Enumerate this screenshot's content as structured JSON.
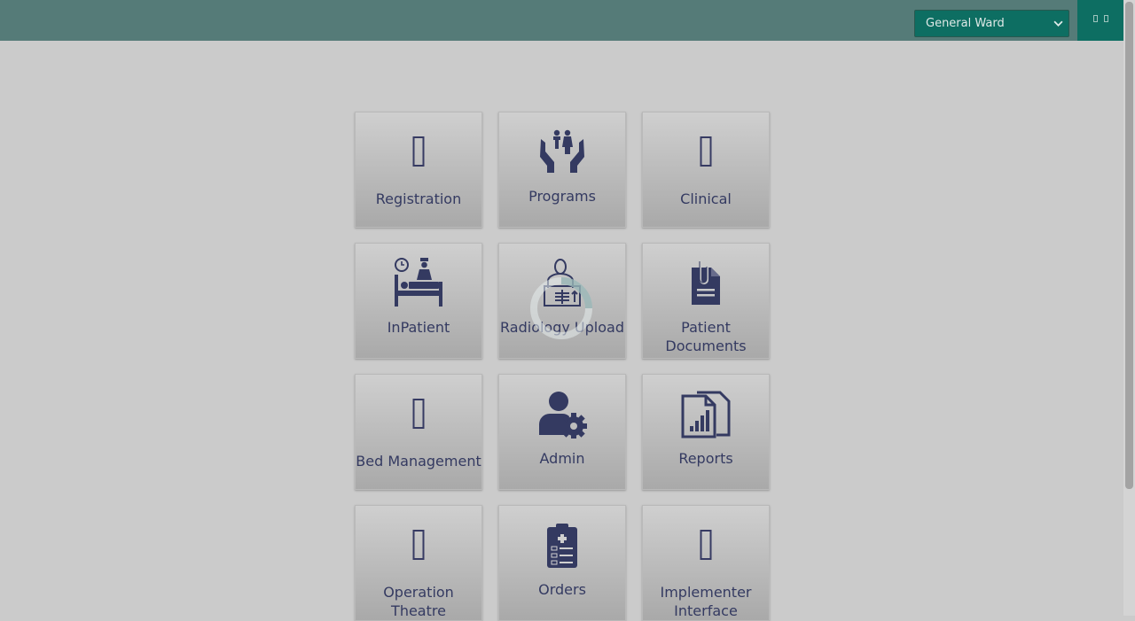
{
  "header": {
    "location_select": {
      "value": "General Ward"
    },
    "user_menu": {
      "icon": "user-menu-icons"
    }
  },
  "apps": [
    {
      "label": "Registration",
      "icon": "missing-glyph-icon"
    },
    {
      "label": "Programs",
      "icon": "family-care-hands-icon"
    },
    {
      "label": "Clinical",
      "icon": "missing-glyph-icon"
    },
    {
      "label": "InPatient",
      "icon": "inpatient-bed-icon"
    },
    {
      "label": "Radiology Upload",
      "icon": "radiology-icon"
    },
    {
      "label": "Patient Documents",
      "icon": "document-clip-icon"
    },
    {
      "label": "Bed Management",
      "icon": "missing-glyph-icon"
    },
    {
      "label": "Admin",
      "icon": "user-gear-icon"
    },
    {
      "label": "Reports",
      "icon": "report-chart-icon"
    },
    {
      "label": "Operation Theatre",
      "icon": "missing-glyph-icon"
    },
    {
      "label": "Orders",
      "icon": "clipboard-list-icon"
    },
    {
      "label": "Implementer Interface",
      "icon": "missing-glyph-icon"
    }
  ],
  "colors": {
    "header": "#557b78",
    "accent": "#0d6e62",
    "page_background": "#cbcbcb",
    "tile_text": "#343a61"
  }
}
